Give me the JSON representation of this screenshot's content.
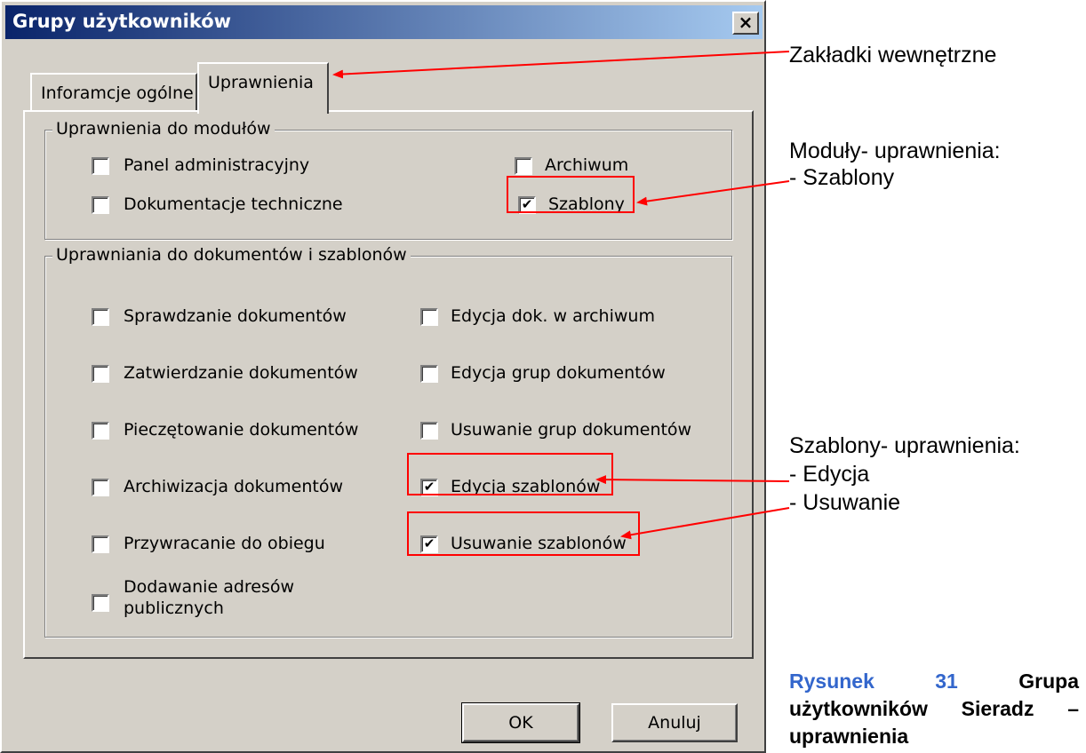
{
  "window": {
    "title": "Grupy użytkowników",
    "close_glyph": "×"
  },
  "tabs": [
    {
      "label": "Inforamcje ogólne",
      "active": false
    },
    {
      "label": "Uprawnienia",
      "active": true
    }
  ],
  "modules": {
    "legend": "Uprawnienia do modułów",
    "items": [
      {
        "label": "Panel administracyjny",
        "checked": false
      },
      {
        "label": "Archiwum",
        "checked": false
      },
      {
        "label": "Dokumentacje techniczne",
        "checked": false
      },
      {
        "label": "Szablony",
        "checked": true
      }
    ]
  },
  "documents": {
    "legend": "Uprawniania do dokumentów i szablonów",
    "items": [
      {
        "label": "Sprawdzanie dokumentów",
        "checked": false
      },
      {
        "label": "Edycja dok. w archiwum",
        "checked": false
      },
      {
        "label": "Zatwierdzanie dokumentów",
        "checked": false
      },
      {
        "label": "Edycja grup dokumentów",
        "checked": false
      },
      {
        "label": "Pieczętowanie dokumentów",
        "checked": false
      },
      {
        "label": "Usuwanie grup dokumentów",
        "checked": false
      },
      {
        "label": "Archiwizacja dokumentów",
        "checked": false
      },
      {
        "label": "Edycja szablonów",
        "checked": true
      },
      {
        "label": "Przywracanie do obiegu",
        "checked": false
      },
      {
        "label": "Usuwanie szablonów",
        "checked": true
      },
      {
        "label_line1": "Dodawanie adresów",
        "label_line2": "publicznych",
        "checked": false
      }
    ]
  },
  "buttons": {
    "ok": "OK",
    "cancel": "Anuluj"
  },
  "annotations": {
    "tabs_note": "Zakładki wewnętrzne",
    "modules_note_title": "Moduły- uprawnienia:",
    "modules_note_item": "- Szablony",
    "templates_note_title": "Szablony- uprawnienia:",
    "templates_note_item1": "- Edycja",
    "templates_note_item2": "- Usuwanie",
    "arrow_color": "#ff0000"
  },
  "caption": {
    "prefix": "Rysunek",
    "number": "31",
    "word1": "Grupa",
    "line2_a": "użytkowników",
    "line2_b": "Sieradz",
    "line2_c": "–",
    "line3": "uprawnienia"
  },
  "check_glyph": "✔"
}
